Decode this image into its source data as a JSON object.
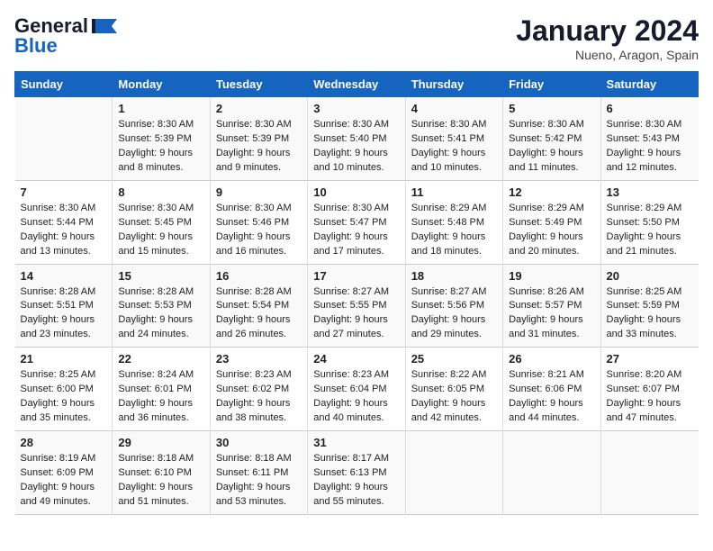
{
  "header": {
    "logo_line1": "General",
    "logo_line2": "Blue",
    "month_title": "January 2024",
    "location": "Nueno, Aragon, Spain"
  },
  "days_of_week": [
    "Sunday",
    "Monday",
    "Tuesday",
    "Wednesday",
    "Thursday",
    "Friday",
    "Saturday"
  ],
  "weeks": [
    [
      {
        "day": "",
        "sunrise": "",
        "sunset": "",
        "daylight": ""
      },
      {
        "day": "1",
        "sunrise": "Sunrise: 8:30 AM",
        "sunset": "Sunset: 5:39 PM",
        "daylight": "Daylight: 9 hours and 8 minutes."
      },
      {
        "day": "2",
        "sunrise": "Sunrise: 8:30 AM",
        "sunset": "Sunset: 5:39 PM",
        "daylight": "Daylight: 9 hours and 9 minutes."
      },
      {
        "day": "3",
        "sunrise": "Sunrise: 8:30 AM",
        "sunset": "Sunset: 5:40 PM",
        "daylight": "Daylight: 9 hours and 10 minutes."
      },
      {
        "day": "4",
        "sunrise": "Sunrise: 8:30 AM",
        "sunset": "Sunset: 5:41 PM",
        "daylight": "Daylight: 9 hours and 10 minutes."
      },
      {
        "day": "5",
        "sunrise": "Sunrise: 8:30 AM",
        "sunset": "Sunset: 5:42 PM",
        "daylight": "Daylight: 9 hours and 11 minutes."
      },
      {
        "day": "6",
        "sunrise": "Sunrise: 8:30 AM",
        "sunset": "Sunset: 5:43 PM",
        "daylight": "Daylight: 9 hours and 12 minutes."
      }
    ],
    [
      {
        "day": "7",
        "sunrise": "Sunrise: 8:30 AM",
        "sunset": "Sunset: 5:44 PM",
        "daylight": "Daylight: 9 hours and 13 minutes."
      },
      {
        "day": "8",
        "sunrise": "Sunrise: 8:30 AM",
        "sunset": "Sunset: 5:45 PM",
        "daylight": "Daylight: 9 hours and 15 minutes."
      },
      {
        "day": "9",
        "sunrise": "Sunrise: 8:30 AM",
        "sunset": "Sunset: 5:46 PM",
        "daylight": "Daylight: 9 hours and 16 minutes."
      },
      {
        "day": "10",
        "sunrise": "Sunrise: 8:30 AM",
        "sunset": "Sunset: 5:47 PM",
        "daylight": "Daylight: 9 hours and 17 minutes."
      },
      {
        "day": "11",
        "sunrise": "Sunrise: 8:29 AM",
        "sunset": "Sunset: 5:48 PM",
        "daylight": "Daylight: 9 hours and 18 minutes."
      },
      {
        "day": "12",
        "sunrise": "Sunrise: 8:29 AM",
        "sunset": "Sunset: 5:49 PM",
        "daylight": "Daylight: 9 hours and 20 minutes."
      },
      {
        "day": "13",
        "sunrise": "Sunrise: 8:29 AM",
        "sunset": "Sunset: 5:50 PM",
        "daylight": "Daylight: 9 hours and 21 minutes."
      }
    ],
    [
      {
        "day": "14",
        "sunrise": "Sunrise: 8:28 AM",
        "sunset": "Sunset: 5:51 PM",
        "daylight": "Daylight: 9 hours and 23 minutes."
      },
      {
        "day": "15",
        "sunrise": "Sunrise: 8:28 AM",
        "sunset": "Sunset: 5:53 PM",
        "daylight": "Daylight: 9 hours and 24 minutes."
      },
      {
        "day": "16",
        "sunrise": "Sunrise: 8:28 AM",
        "sunset": "Sunset: 5:54 PM",
        "daylight": "Daylight: 9 hours and 26 minutes."
      },
      {
        "day": "17",
        "sunrise": "Sunrise: 8:27 AM",
        "sunset": "Sunset: 5:55 PM",
        "daylight": "Daylight: 9 hours and 27 minutes."
      },
      {
        "day": "18",
        "sunrise": "Sunrise: 8:27 AM",
        "sunset": "Sunset: 5:56 PM",
        "daylight": "Daylight: 9 hours and 29 minutes."
      },
      {
        "day": "19",
        "sunrise": "Sunrise: 8:26 AM",
        "sunset": "Sunset: 5:57 PM",
        "daylight": "Daylight: 9 hours and 31 minutes."
      },
      {
        "day": "20",
        "sunrise": "Sunrise: 8:25 AM",
        "sunset": "Sunset: 5:59 PM",
        "daylight": "Daylight: 9 hours and 33 minutes."
      }
    ],
    [
      {
        "day": "21",
        "sunrise": "Sunrise: 8:25 AM",
        "sunset": "Sunset: 6:00 PM",
        "daylight": "Daylight: 9 hours and 35 minutes."
      },
      {
        "day": "22",
        "sunrise": "Sunrise: 8:24 AM",
        "sunset": "Sunset: 6:01 PM",
        "daylight": "Daylight: 9 hours and 36 minutes."
      },
      {
        "day": "23",
        "sunrise": "Sunrise: 8:23 AM",
        "sunset": "Sunset: 6:02 PM",
        "daylight": "Daylight: 9 hours and 38 minutes."
      },
      {
        "day": "24",
        "sunrise": "Sunrise: 8:23 AM",
        "sunset": "Sunset: 6:04 PM",
        "daylight": "Daylight: 9 hours and 40 minutes."
      },
      {
        "day": "25",
        "sunrise": "Sunrise: 8:22 AM",
        "sunset": "Sunset: 6:05 PM",
        "daylight": "Daylight: 9 hours and 42 minutes."
      },
      {
        "day": "26",
        "sunrise": "Sunrise: 8:21 AM",
        "sunset": "Sunset: 6:06 PM",
        "daylight": "Daylight: 9 hours and 44 minutes."
      },
      {
        "day": "27",
        "sunrise": "Sunrise: 8:20 AM",
        "sunset": "Sunset: 6:07 PM",
        "daylight": "Daylight: 9 hours and 47 minutes."
      }
    ],
    [
      {
        "day": "28",
        "sunrise": "Sunrise: 8:19 AM",
        "sunset": "Sunset: 6:09 PM",
        "daylight": "Daylight: 9 hours and 49 minutes."
      },
      {
        "day": "29",
        "sunrise": "Sunrise: 8:18 AM",
        "sunset": "Sunset: 6:10 PM",
        "daylight": "Daylight: 9 hours and 51 minutes."
      },
      {
        "day": "30",
        "sunrise": "Sunrise: 8:18 AM",
        "sunset": "Sunset: 6:11 PM",
        "daylight": "Daylight: 9 hours and 53 minutes."
      },
      {
        "day": "31",
        "sunrise": "Sunrise: 8:17 AM",
        "sunset": "Sunset: 6:13 PM",
        "daylight": "Daylight: 9 hours and 55 minutes."
      },
      {
        "day": "",
        "sunrise": "",
        "sunset": "",
        "daylight": ""
      },
      {
        "day": "",
        "sunrise": "",
        "sunset": "",
        "daylight": ""
      },
      {
        "day": "",
        "sunrise": "",
        "sunset": "",
        "daylight": ""
      }
    ]
  ]
}
